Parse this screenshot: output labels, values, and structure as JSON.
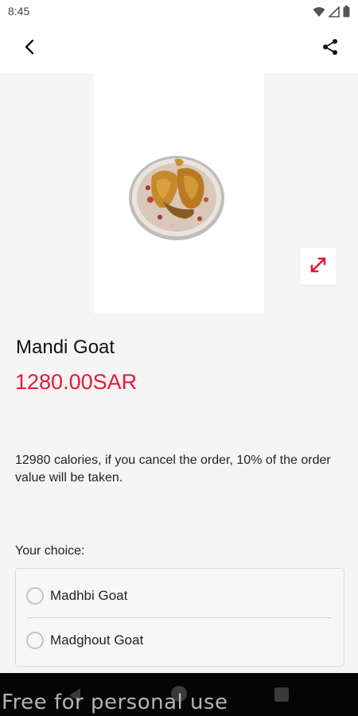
{
  "status_bar": {
    "time": "8:45",
    "icons": [
      "wifi-icon",
      "signal-icon",
      "battery-icon"
    ]
  },
  "app_bar": {
    "back_icon": "chevron-left-icon",
    "share_icon": "share-icon"
  },
  "product": {
    "image_alt": "Mandi Goat plate",
    "expand_icon": "expand-icon",
    "name": "Mandi Goat",
    "price": "1280.00SAR",
    "description": "12980 calories, if you cancel the order, 10% of the order value will be taken."
  },
  "choices": {
    "heading": "Your choice:",
    "options": [
      {
        "label": "Madhbi Goat",
        "selected": false
      },
      {
        "label": "Madghout Goat",
        "selected": false
      }
    ]
  },
  "nav_bar": {
    "icons": [
      "nav-back-icon",
      "nav-home-icon",
      "nav-recents-icon"
    ]
  },
  "watermark": "Free for personal use",
  "colors": {
    "accent": "#e8163b",
    "background": "#f5f5f5",
    "card": "#ffffff",
    "nav_bar": "#050505"
  }
}
